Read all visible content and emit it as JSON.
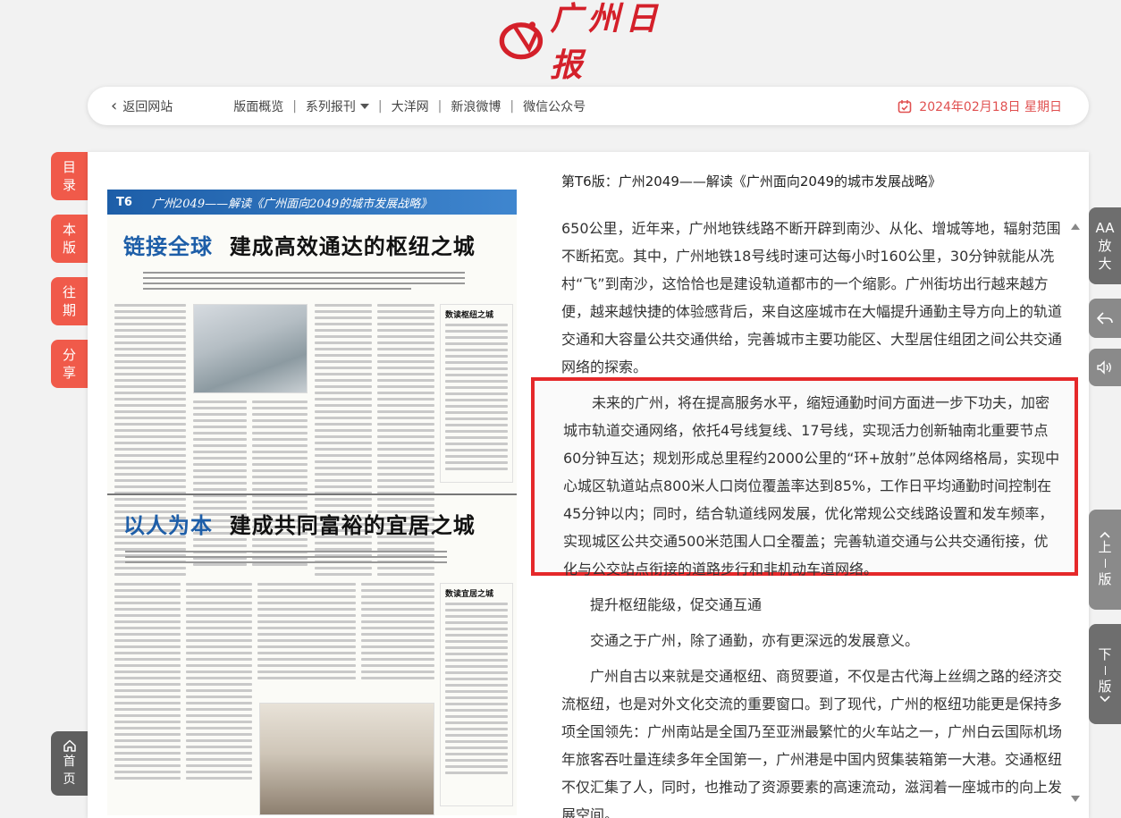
{
  "logo": {
    "text": "广州日报"
  },
  "nav": {
    "back": "返回网站",
    "links": [
      "版面概览",
      "系列报刊",
      "大洋网",
      "新浪微博",
      "微信公众号"
    ],
    "date": "2024年02月18日 星期日"
  },
  "side_left": [
    {
      "top": "目",
      "bottom": "录"
    },
    {
      "top": "本",
      "bottom": "版"
    },
    {
      "top": "往",
      "bottom": "期"
    },
    {
      "top": "分",
      "bottom": "享"
    }
  ],
  "home": {
    "top": "首",
    "bottom": "页"
  },
  "side_right": {
    "font_label": "AA",
    "font_top": "放",
    "font_bottom": "大",
    "prev": [
      "上",
      "一",
      "版"
    ],
    "next": [
      "下",
      "一",
      "版"
    ]
  },
  "paper": {
    "page_tag": "T6",
    "banner_title": "广州2049——解读《广州面向2049的城市发展战略》",
    "headline1_a": "链接全球",
    "headline1_b": "建成高效通达的枢纽之城",
    "headline2_a": "以人为本",
    "headline2_b": "建成共同富裕的宜居之城",
    "sub1": "数读枢纽之城",
    "sub2": "数读宜居之城"
  },
  "article": {
    "title": "第T6版：广州2049——解读《广州面向2049的城市发展战略》",
    "p1": "650公里，近年来，广州地铁线路不断开辟到南沙、从化、增城等地，辐射范围不断拓宽。其中，广州地铁18号线时速可达每小时160公里，30分钟就能从冼村“飞”到南沙，这恰恰也是建设轨道都市的一个缩影。广州街坊出行越来越方便，越来越快捷的体验感背后，来自这座城市在大幅提升通勤主导方向上的轨道交通和大容量公共交通供给，完善城市主要功能区、大型居住组团之间公共交通网络的探索。",
    "highlight": "未来的广州，将在提高服务水平，缩短通勤时间方面进一步下功夫，加密城市轨道交通网络，依托4号线复线、17号线，实现活力创新轴南北重要节点60分钟互达；规划形成总里程约2000公里的“环+放射”总体网络格局，实现中心城区轨道站点800米人口岗位覆盖率达到85%，工作日平均通勤时间控制在45分钟以内；同时，结合轨道线网发展，优化常规公交线路设置和发车频率，实现城区公共交通500米范围人口全覆盖；完善轨道交通与公共交通衔接，优化与公交站点衔接的道路步行和非机动车道网络。",
    "p2": "提升枢纽能级，促交通互通",
    "p3": "交通之于广州，除了通勤，亦有更深远的发展意义。",
    "p4": "广州自古以来就是交通枢纽、商贸要道，不仅是古代海上丝绸之路的经济交流枢纽，也是对外文化交流的重要窗口。到了现代，广州的枢纽功能更是保持多项全国领先：广州南站是全国乃至亚洲最繁忙的火车站之一，广州白云国际机场年旅客吞吐量连续多年全国第一，广州港是中国内贸集装箱第一大港。交通枢纽不仅汇集了人，同时，也推动了资源要素的高速流动，滋润着一座城市的向上发展空间。"
  }
}
